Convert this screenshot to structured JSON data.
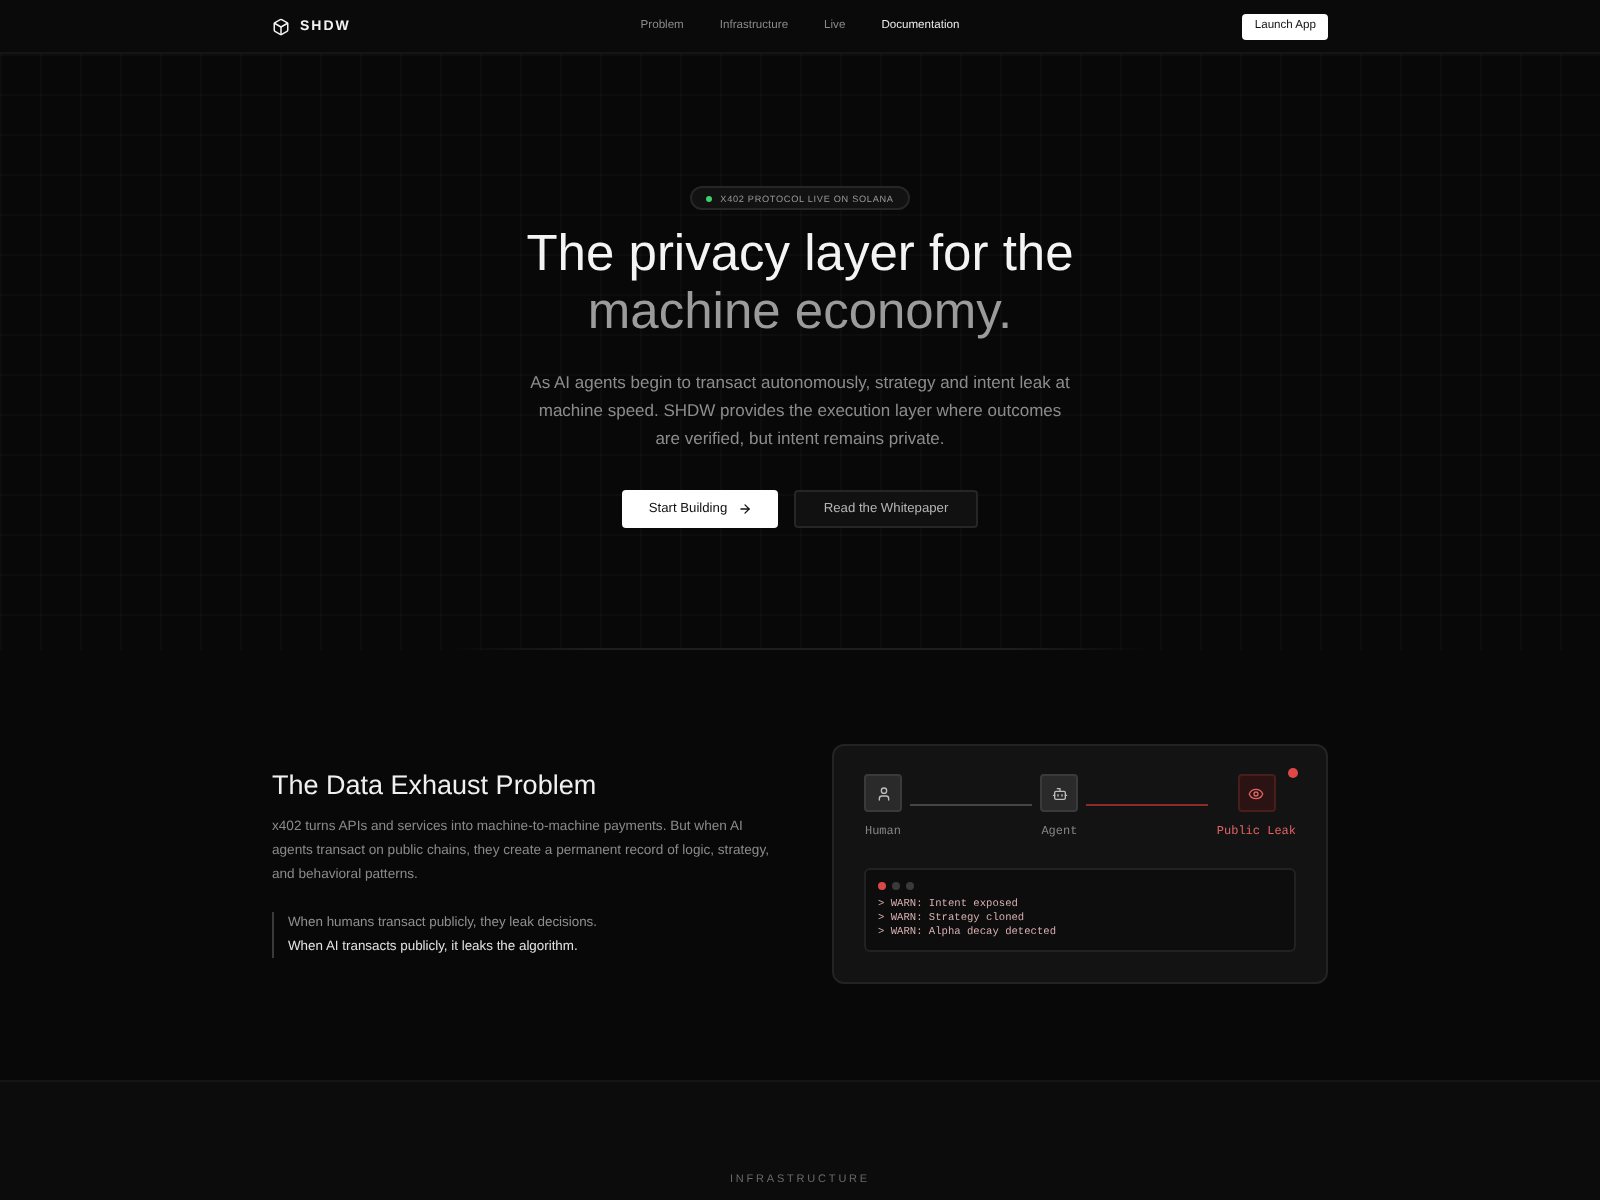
{
  "nav": {
    "logo": "SHDW",
    "links": [
      {
        "label": "Problem",
        "selected": false
      },
      {
        "label": "Infrastructure",
        "selected": false
      },
      {
        "label": "Live",
        "selected": false
      },
      {
        "label": "Documentation",
        "selected": true
      }
    ],
    "action": "Launch App"
  },
  "hero": {
    "badge": {
      "label": "X402 PROTOCOL LIVE ON SOLANA",
      "live": true
    },
    "title": "The privacy layer for the",
    "title_accent": "machine economy.",
    "description": "As AI agents begin to transact autonomously, strategy and intent leak at machine speed. SHDW provides the execution layer where outcomes are verified, but intent remains private.",
    "buttons": [
      {
        "label": "Start Building",
        "kind": "primary"
      },
      {
        "label": "Read the Whitepaper",
        "kind": "secondary"
      }
    ]
  },
  "problem": {
    "title": "The Data Exhaust Problem",
    "description": "x402 turns APIs and services into machine-to-machine payments. But when AI agents transact on public chains, they create a permanent record of logic, strategy, and behavioral patterns.",
    "quote": [
      {
        "text": "When humans transact publicly, they leak decisions.",
        "emphasized": false
      },
      {
        "text": "When AI transacts publicly, it leaks the algorithm.",
        "emphasized": true
      }
    ],
    "flow": {
      "alert": true,
      "nodes": [
        {
          "label": "Human",
          "kind": "human"
        },
        {
          "label": "Agent",
          "kind": "agent"
        },
        {
          "label": "Public Leak",
          "kind": "leak"
        }
      ]
    },
    "terminal": [
      "> WARN: Intent exposed",
      "> WARN: Strategy cloned",
      "> WARN: Alpha decay detected"
    ]
  },
  "infrastructure": {
    "eyebrow": "INFRASTRUCTURE"
  }
}
